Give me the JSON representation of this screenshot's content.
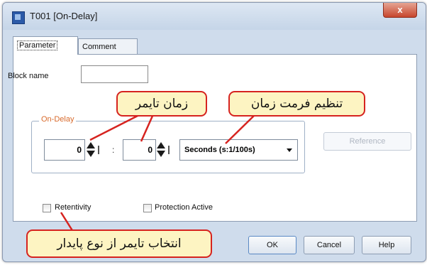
{
  "window": {
    "title": "T001 [On-Delay]",
    "close_label": "x"
  },
  "tabs": [
    {
      "label": "Parameter",
      "active": true
    },
    {
      "label": "Comment",
      "active": false
    }
  ],
  "parameter": {
    "block_name_label": "Block name",
    "block_name_value": "",
    "ondelay_group_label": "On-Delay",
    "value_1": "0",
    "separator": ":",
    "value_2": "0",
    "time_unit_selected": "Seconds (s:1/100s)",
    "reference_label": "Reference",
    "retentivity_label": "Retentivity",
    "retentivity_checked": false,
    "protection_label": "Protection Active",
    "protection_checked": false
  },
  "buttons": {
    "ok": "OK",
    "cancel": "Cancel",
    "help": "Help"
  },
  "annotations": {
    "timer_time": "زمان تایمر",
    "time_format": "تنظیم فرمت زمان",
    "retentive_timer": "انتخاب تایمر از نوع پایدار",
    "callout_border_color": "#d6231f",
    "callout_fill_color": "#fdf4c2"
  },
  "colors": {
    "window_background": "#cfdcec",
    "ondelay_label_color": "#d86a2c",
    "close_button": "#c7462d"
  }
}
